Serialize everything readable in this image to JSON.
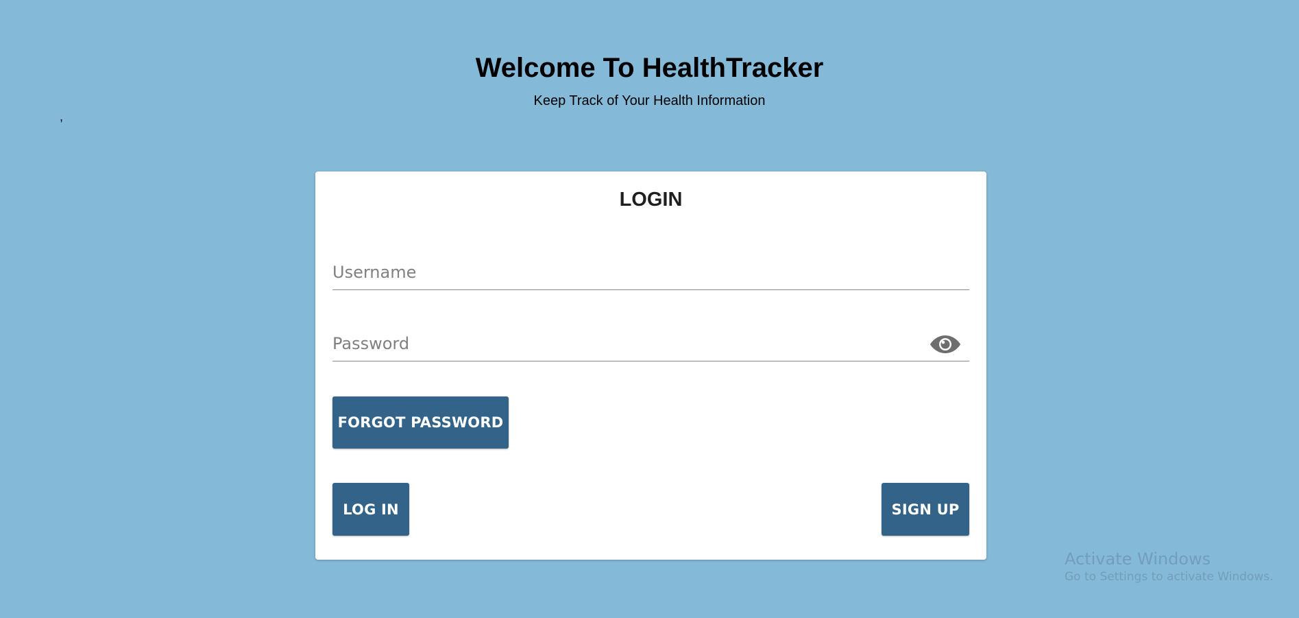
{
  "header": {
    "title": "Welcome To HealthTracker",
    "subtitle": "Keep Track of Your Health Information",
    "stray_text": ","
  },
  "login_card": {
    "title": "LOGIN",
    "username": {
      "value": "",
      "placeholder": "Username"
    },
    "password": {
      "value": "",
      "placeholder": "Password",
      "toggle_icon": "eye-icon"
    },
    "forgot_password_label": "FORGOT PASSWORD",
    "login_label": "LOG IN",
    "signup_label": "SIGN UP"
  },
  "watermark": {
    "title": "Activate Windows",
    "subtitle": "Go to Settings to activate Windows."
  },
  "colors": {
    "background": "#84b9d8",
    "card": "#ffffff",
    "button": "#336388",
    "button_text": "#ffffff"
  }
}
